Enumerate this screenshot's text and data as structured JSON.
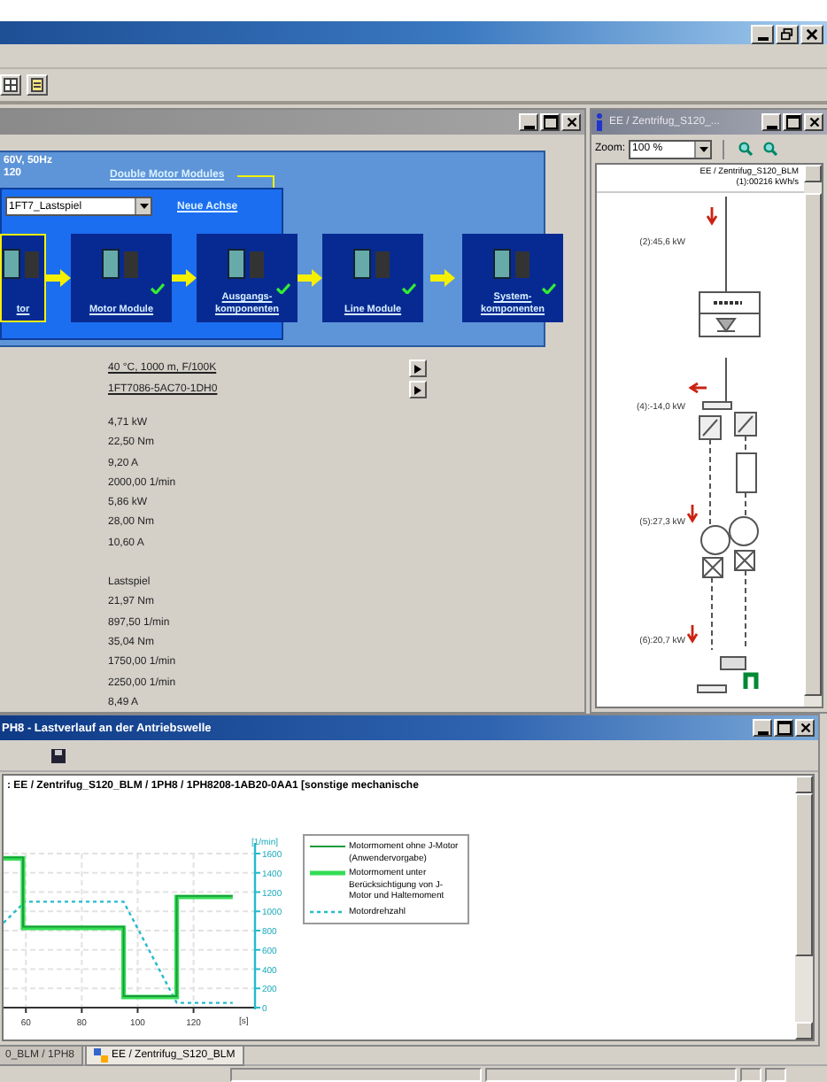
{
  "left_window": {
    "config": {
      "header_lines": [
        "60V, 50Hz",
        "120"
      ],
      "double_motor_link": "Double Motor Modules",
      "dropdown_value": "1FT7_Lastspiel",
      "new_axis_link": "Neue Achse",
      "cards": [
        {
          "label": "tor",
          "done": false,
          "selected": true
        },
        {
          "label": "Motor Module",
          "done": true,
          "selected": false
        },
        {
          "label": "Ausgangs-\nkomponenten",
          "done": true,
          "selected": false
        },
        {
          "label": "Line Module",
          "done": true,
          "selected": false
        },
        {
          "label": "System-\nkomponenten",
          "done": true,
          "selected": false
        }
      ]
    },
    "links": [
      "40 °C, 1000 m, F/100K",
      "1FT7086-5AC70-1DH0"
    ],
    "value_groups": [
      [
        "4,71 kW",
        "22,50 Nm",
        "9,20 A",
        "2000,00 1/min",
        "5,86 kW",
        "28,00 Nm",
        "10,60 A"
      ],
      [
        "Lastspiel",
        "21,97 Nm",
        "897,50 1/min",
        "35,04 Nm",
        "1750,00 1/min",
        "2250,00 1/min",
        "8,49 A"
      ]
    ]
  },
  "right_window": {
    "title": "EE / Zentrifug_S120_...",
    "zoom_label": "Zoom:",
    "zoom_value": "100 %",
    "diagram_title": "EE / Zentrifug_S120_BLM",
    "diagram_subtitle": "(1):00216 kWh/s",
    "power_labels": [
      "(2):45,6 kW",
      "(4):-14,0 kW",
      "(5):27,3 kW",
      "(6):20,7 kW"
    ]
  },
  "bottom_window": {
    "title": "PH8 - Lastverlauf an der Antriebswelle",
    "heading": ": EE / Zentrifug_S120_BLM / 1PH8 / 1PH8208-1AB20-0AA1 [sonstige mechanische",
    "chart_data": {
      "type": "line",
      "grid": true,
      "ylabel": "[1/min]",
      "xlabel": "[s]",
      "x": [
        52,
        59,
        59,
        95,
        95,
        114,
        114,
        134
      ],
      "xlim": [
        52,
        142
      ],
      "ylim": [
        0,
        1600
      ],
      "xticks": [
        60,
        80,
        100,
        120
      ],
      "yticks": [
        0,
        200,
        400,
        600,
        800,
        1000,
        1200,
        1400,
        1600
      ],
      "series": [
        {
          "name": "Motormoment ohne J-Motor (Anwendervorgabe)",
          "color": "#1a9a3a",
          "line_style": "solid",
          "values": [
            1560,
            1560,
            840,
            840,
            120,
            120,
            1160,
            1160
          ]
        },
        {
          "name": "Motormoment unter Berücksichtigung von J-Motor und Haltemoment",
          "color": "#33dd55",
          "line_style": "solid",
          "values": [
            1550,
            1550,
            830,
            830,
            110,
            110,
            1150,
            1150
          ]
        },
        {
          "name": "Motordrehzahl",
          "color": "#22bbcc",
          "line_style": "dashed",
          "values": [
            880,
            1080,
            1100,
            1100,
            1100,
            50,
            50,
            50
          ]
        }
      ]
    }
  },
  "tabs": [
    {
      "label": "0_BLM / 1PH8",
      "selected": false
    },
    {
      "label": "EE / Zentrifug_S120_BLM",
      "selected": true
    }
  ]
}
